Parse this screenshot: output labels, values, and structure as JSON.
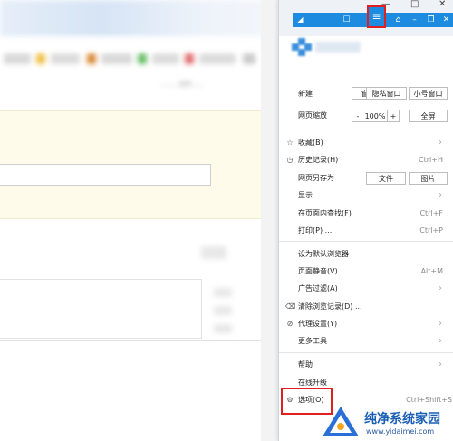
{
  "background": {
    "blurred_text": "……，文丹……"
  },
  "window": {
    "minimize": "—",
    "maximize": "□",
    "close": "✕"
  },
  "toolbar": {
    "menu_button": "≡"
  },
  "menu": {
    "new_label": "新建",
    "new_buttons": [
      "窗 口",
      "隐私窗口",
      "小号窗口"
    ],
    "zoom_label": "网页缩放",
    "zoom_minus": "-",
    "zoom_value": "100%",
    "zoom_plus": "+",
    "fullscreen": "全屏",
    "items": [
      {
        "icon": "☆",
        "label": "收藏(B)",
        "shortcut": "",
        "arrow": "›"
      },
      {
        "icon": "◷",
        "label": "历史记录(H)",
        "shortcut": "Ctrl+H",
        "arrow": ""
      },
      {
        "icon": "",
        "label": "网页另存为",
        "shortcut": "",
        "arrow": ""
      },
      {
        "icon": "",
        "label": "显示",
        "shortcut": "",
        "arrow": "›"
      },
      {
        "icon": "",
        "label": "在页面内查找(F)",
        "shortcut": "Ctrl+F",
        "arrow": ""
      },
      {
        "icon": "",
        "label": "打印(P) ...",
        "shortcut": "Ctrl+P",
        "arrow": ""
      },
      {
        "icon": "",
        "label": "设为默认浏览器",
        "shortcut": "",
        "arrow": ""
      },
      {
        "icon": "",
        "label": "页面静音(V)",
        "shortcut": "Alt+M",
        "arrow": ""
      },
      {
        "icon": "",
        "label": "广告过滤(A)",
        "shortcut": "",
        "arrow": "›"
      },
      {
        "icon": "⌫",
        "label": "清除浏览记录(D) ...",
        "shortcut": "",
        "arrow": ""
      },
      {
        "icon": "⊘",
        "label": "代理设置(Y)",
        "shortcut": "",
        "arrow": "›"
      },
      {
        "icon": "",
        "label": "更多工具",
        "shortcut": "",
        "arrow": "›"
      },
      {
        "icon": "",
        "label": "帮助",
        "shortcut": "",
        "arrow": "›"
      },
      {
        "icon": "",
        "label": "在线升级",
        "shortcut": "",
        "arrow": ""
      },
      {
        "icon": "⚙",
        "label": "选项(O)",
        "shortcut": "Ctrl+Shift+S",
        "arrow": ""
      }
    ],
    "save_as_buttons": [
      "文件",
      "图片"
    ]
  },
  "watermark": {
    "title": "纯净系统家园",
    "url": "www.yidaimei.com"
  },
  "colors": {
    "accent": "#1d8ce0",
    "highlight": "#e02020"
  }
}
